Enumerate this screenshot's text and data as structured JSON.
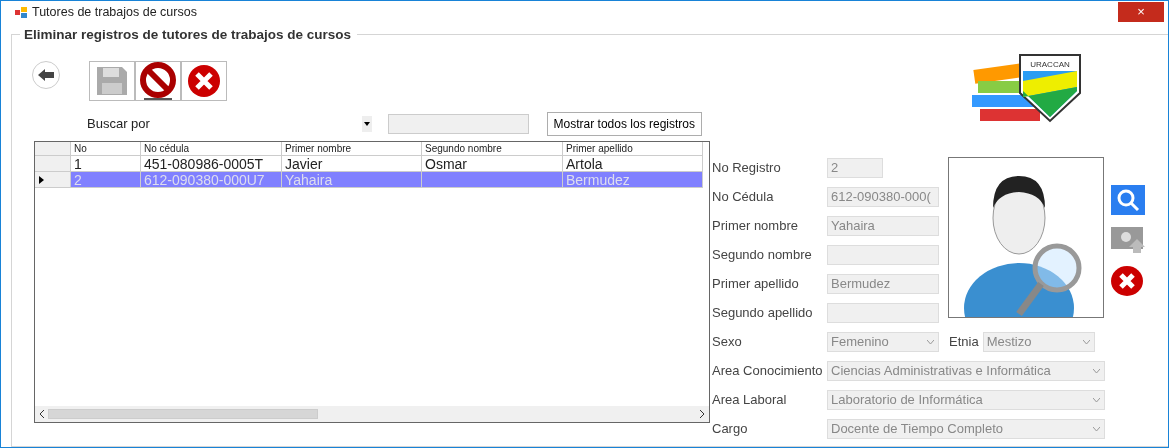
{
  "window": {
    "title": "Tutores de trabajos de cursos",
    "close": "×"
  },
  "group_title": "Eliminar registros de tutores de trabajos de cursos",
  "toolbar": [
    {
      "kind": "save",
      "disabled": true
    },
    {
      "kind": "cancel",
      "disabled": false
    },
    {
      "kind": "delete",
      "disabled": false
    }
  ],
  "search": {
    "label": "Buscar por",
    "button": "Mostrar todos los registros"
  },
  "table": {
    "columns": [
      "No",
      "No cédula",
      "Primer nombre",
      "Segundo nombre",
      "Primer apellido"
    ],
    "rows": [
      {
        "cells": [
          "1",
          "451-080986-0005T",
          "Javier",
          "Osmar",
          "Artola"
        ],
        "selected": false
      },
      {
        "cells": [
          "2",
          "612-090380-000U7",
          "Yahaira",
          "",
          "Bermudez"
        ],
        "selected": true
      }
    ]
  },
  "logo": {
    "text": "URACCAN"
  },
  "form": [
    [
      {
        "label": "No Registro",
        "value": "2",
        "kind": "text"
      }
    ],
    [
      {
        "label": "No Cédula",
        "value": "612-090380-000(",
        "kind": "text"
      }
    ],
    [
      {
        "label": "Primer nombre",
        "value": "Yahaira",
        "kind": "text"
      }
    ],
    [
      {
        "label": "Segundo nombre",
        "kind": "text"
      }
    ],
    [
      {
        "label": "Primer apellido",
        "value": "Bermudez",
        "kind": "text"
      }
    ],
    [
      {
        "label": "Segundo apellido",
        "kind": "text"
      }
    ],
    [
      {
        "label": "Sexo",
        "value": "Femenino",
        "kind": "combo"
      },
      {
        "label": "Etnia",
        "value": "Mestizo",
        "kind": "combo"
      }
    ],
    [
      {
        "label": "Area Conocimiento",
        "value": "Ciencias Administrativas e Informática",
        "kind": "combo"
      }
    ],
    [
      {
        "label": "Area Laboral",
        "value": "Laboratorio de Informática",
        "kind": "combo"
      }
    ],
    [
      {
        "label": "Cargo",
        "value": "Docente de Tiempo Completo",
        "kind": "combo"
      }
    ]
  ]
}
